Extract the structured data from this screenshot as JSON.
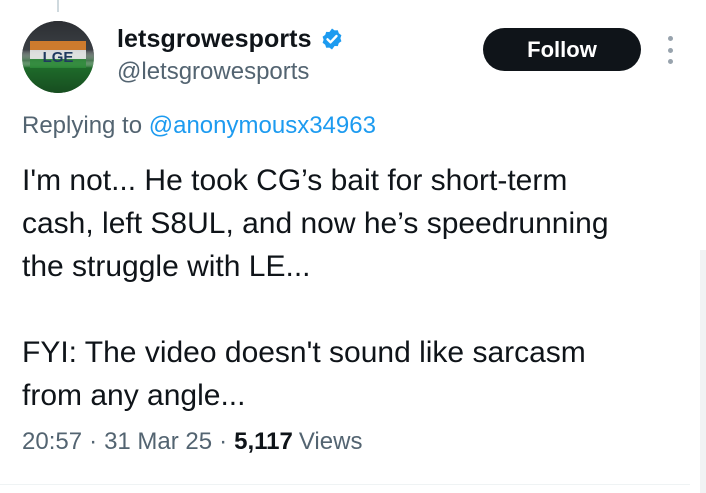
{
  "user": {
    "display_name": "letsgrowesports",
    "handle": "@letsgrowesports",
    "verified": true,
    "avatar_text": "LGE"
  },
  "actions": {
    "follow_label": "Follow"
  },
  "reply": {
    "prefix": "Replying to",
    "mention": "@anonymousx34963"
  },
  "tweet": {
    "paragraph_1": "I'm not... He took CG’s bait for short-term\ncash, left S8UL, and now he’s speedrunning\nthe struggle with LE...",
    "paragraph_2": "FYI: The video doesn't sound like sarcasm\nfrom any angle..."
  },
  "meta": {
    "time": "20:57",
    "separator": "·",
    "date": "31 Mar 25",
    "views_count": "5,117",
    "views_label": "Views"
  },
  "colors": {
    "text": "#0f1419",
    "secondary": "#536471",
    "link": "#1d9bf0",
    "follow_bg": "#0f1419",
    "verified": "#1d9bf0"
  },
  "icons": {
    "verified": "verified-badge-icon",
    "more": "more-options-icon"
  }
}
